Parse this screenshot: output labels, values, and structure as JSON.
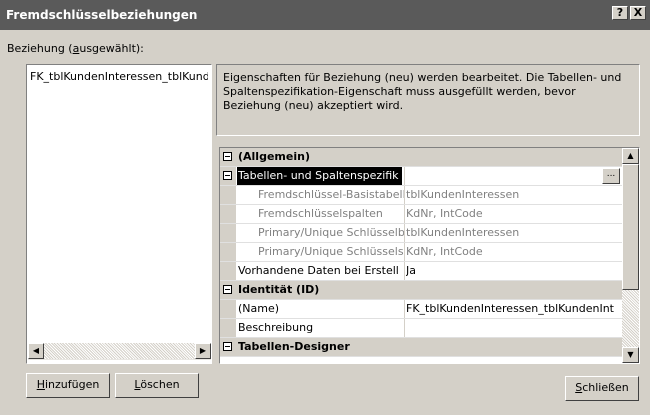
{
  "window": {
    "title": "Fremdschlüsselbeziehungen",
    "help_label": "?",
    "close_label": "X"
  },
  "relations": {
    "label_pre": "Beziehung (",
    "label_ul": "a",
    "label_post": "usgewählt):",
    "items": [
      {
        "label": "FK_tblKundenInteressen_tblKunden"
      }
    ]
  },
  "buttons": {
    "add_ul": "H",
    "add_rest": "inzufügen",
    "delete_ul": "L",
    "delete_rest": "öschen",
    "close_ul": "S",
    "close_rest": "chließen"
  },
  "info_text": "Eigenschaften für Beziehung (neu) werden bearbeitet.  Die Tabellen- und Spaltenspezifikation-Eigenschaft muss ausgefüllt werden, bevor Beziehung (neu) akzeptiert wird.",
  "properties": {
    "general": "(Allgemein)",
    "table_spec": "Tabellen- und Spaltenspezifik",
    "fk_base_table": {
      "name": "Fremdschlüssel-Basistabell",
      "value": "tblKundenInteressen"
    },
    "fk_columns": {
      "name": "Fremdschlüsselspalten",
      "value": "KdNr, IntCode"
    },
    "pk_table": {
      "name": "Primary/Unique Schlüsselb",
      "value": "tblKundenInteressen"
    },
    "pk_columns": {
      "name": "Primary/Unique Schlüssels",
      "value": "KdNr, IntCode"
    },
    "check_existing": {
      "name": "Vorhandene Daten bei Erstell",
      "value": "Ja"
    },
    "identity": "Identität (ID)",
    "name": {
      "name": "(Name)",
      "value": "FK_tblKundenInteressen_tblKundenInt"
    },
    "description": {
      "name": "Beschreibung",
      "value": ""
    },
    "table_designer": "Tabellen-Designer",
    "ellipsis": "..."
  }
}
